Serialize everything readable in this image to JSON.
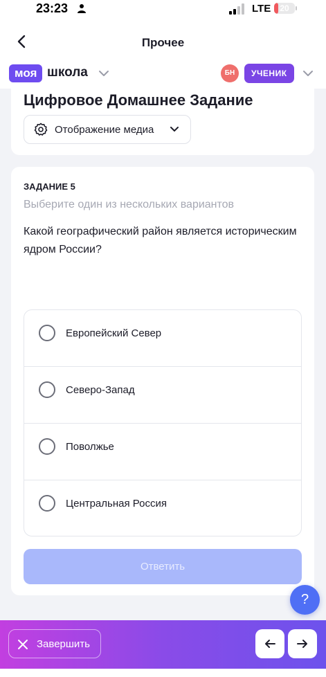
{
  "status_bar": {
    "time": "23:23",
    "network": "LTE",
    "battery": "20",
    "battery_level": 0.2
  },
  "nav": {
    "title": "Прочее"
  },
  "brand": {
    "logo_badge": "моя",
    "logo_text": "школа",
    "avatar_initials": "БН",
    "role": "УЧЕНИК"
  },
  "homework": {
    "title": "Цифровое Домашнее Задание",
    "media_button_label": "Отображение медиа"
  },
  "task": {
    "number_label": "ЗАДАНИЕ 5",
    "hint": "Выберите один из нескольких вариантов",
    "question": "Какой географический район является историческим ядром России?",
    "options": [
      {
        "label": "Европейский Север"
      },
      {
        "label": "Северо-Запад"
      },
      {
        "label": "Поволжье"
      },
      {
        "label": "Центральная Россия"
      }
    ],
    "submit_label": "Ответить"
  },
  "help": {
    "label": "?"
  },
  "bottom": {
    "finish_label": "Завершить"
  },
  "colors": {
    "accent": "#6e4cf0",
    "submit_disabled": "#a9b8fb",
    "help": "#4f6ff5",
    "avatar": "#ef6f6c"
  }
}
